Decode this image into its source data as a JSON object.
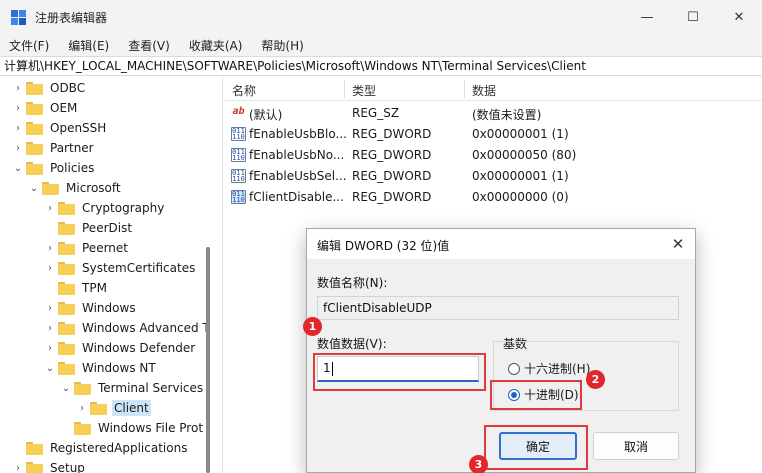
{
  "window": {
    "title": "注册表编辑器",
    "minimize_glyph": "—",
    "maximize_glyph": "☐",
    "close_glyph": "✕"
  },
  "menu": [
    "文件(F)",
    "编辑(E)",
    "查看(V)",
    "收藏夹(A)",
    "帮助(H)"
  ],
  "address": "计算机\\HKEY_LOCAL_MACHINE\\SOFTWARE\\Policies\\Microsoft\\Windows NT\\Terminal Services\\Client",
  "tree": [
    {
      "label": "ODBC",
      "chevron": "›"
    },
    {
      "label": "OEM",
      "chevron": "›"
    },
    {
      "label": "OpenSSH",
      "chevron": "›"
    },
    {
      "label": "Partner",
      "chevron": "›"
    },
    {
      "label": "Policies",
      "chevron": "⌄"
    },
    {
      "label": "Microsoft",
      "chevron": "⌄"
    },
    {
      "label": "Cryptography",
      "chevron": "›"
    },
    {
      "label": "PeerDist",
      "chevron": ""
    },
    {
      "label": "Peernet",
      "chevron": "›"
    },
    {
      "label": "SystemCertificates",
      "chevron": "›"
    },
    {
      "label": "TPM",
      "chevron": ""
    },
    {
      "label": "Windows",
      "chevron": "›"
    },
    {
      "label": "Windows Advanced T",
      "chevron": "›"
    },
    {
      "label": "Windows Defender",
      "chevron": "›"
    },
    {
      "label": "Windows NT",
      "chevron": "⌄"
    },
    {
      "label": "Terminal Services",
      "chevron": "⌄"
    },
    {
      "label": "Client",
      "chevron": "›"
    },
    {
      "label": "Windows File Prot",
      "chevron": ""
    },
    {
      "label": "RegisteredApplications",
      "chevron": ""
    },
    {
      "label": "Setup",
      "chevron": "›"
    }
  ],
  "list": {
    "headers": [
      "名称",
      "类型",
      "数据"
    ],
    "rows": [
      {
        "icon": "ab",
        "name": "(默认)",
        "type": "REG_SZ",
        "data": "(数值未设置)"
      },
      {
        "icon": "bin",
        "name": "fEnableUsbBlo...",
        "type": "REG_DWORD",
        "data": "0x00000001 (1)"
      },
      {
        "icon": "bin",
        "name": "fEnableUsbNo...",
        "type": "REG_DWORD",
        "data": "0x00000050 (80)"
      },
      {
        "icon": "bin",
        "name": "fEnableUsbSel...",
        "type": "REG_DWORD",
        "data": "0x00000001 (1)"
      },
      {
        "icon": "bin",
        "name": "fClientDisable...",
        "type": "REG_DWORD",
        "data": "0x00000000 (0)"
      }
    ]
  },
  "dialog": {
    "title": "编辑 DWORD (32 位)值",
    "value_name_label": "数值名称(N):",
    "value_name": "fClientDisableUDP",
    "value_data_label": "数值数据(V):",
    "value_data": "1",
    "radix_label": "基数",
    "hex_label": "十六进制(H)",
    "dec_label": "十进制(D)",
    "ok_label": "确定",
    "cancel_label": "取消"
  },
  "badges": [
    "1",
    "2",
    "3"
  ],
  "colors": {
    "accent": "#2f6fd0",
    "annotation": "#e03b3b",
    "folder": "#f6cf57"
  }
}
